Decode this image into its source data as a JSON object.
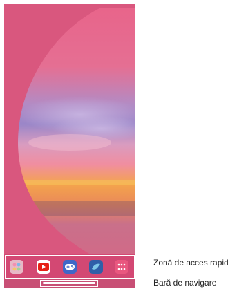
{
  "callouts": {
    "dock_label": "Zonă de acces rapid",
    "navbar_label": "Bară de navigare"
  },
  "dock": {
    "apps": [
      {
        "name": "gallery",
        "icon": "gallery-icon"
      },
      {
        "name": "youtube",
        "icon": "youtube-icon"
      },
      {
        "name": "game-launcher",
        "icon": "gamepad-icon"
      },
      {
        "name": "bird-app",
        "icon": "bird-icon"
      },
      {
        "name": "app-drawer",
        "icon": "apps-grid-icon"
      }
    ]
  },
  "colors": {
    "background": "#d9577e",
    "sky_top": "#e8648a",
    "sky_purple": "#8f7fc4",
    "sunset_orange": "#f2a64b",
    "dock_outline": "#ffffff",
    "leader_line": "#333333"
  }
}
